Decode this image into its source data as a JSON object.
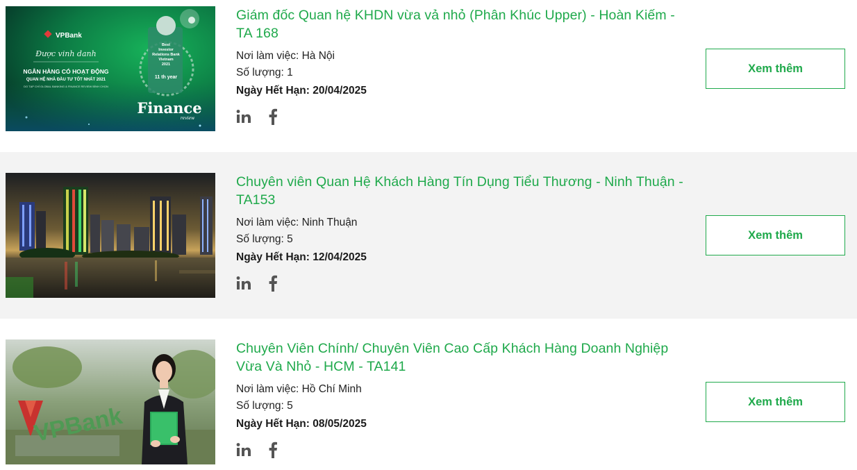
{
  "jobs": [
    {
      "title": "Giám đốc Quan hệ KHDN vừa vả nhỏ (Phân Khúc Upper) - Hoàn Kiếm - TA 168",
      "location_label": "Nơi làm việc:",
      "location": "Hà Nội",
      "quantity_label": "Số lượng:",
      "quantity": "1",
      "deadline_label": "Ngày Hết Hạn:",
      "deadline": "20/04/2025",
      "button": "Xem thêm",
      "image": {
        "brand": "VPBank",
        "script": "Được vinh danh",
        "headline1": "NGÂN HÀNG CÓ HOẠT ĐỘNG",
        "headline2": "QUAN HỆ NHÀ ĐẦU TƯ TỐT NHẤT 2021",
        "small": "DO TẠP CHÍ GLOBAL BANKING & FINANCE REVIEW BÌNH CHỌN",
        "award1": "Best",
        "award2": "Investor",
        "award3": "Relations Bank",
        "award4": "Vietnam",
        "award5": "2021",
        "award6": "11 th year",
        "award_big": "Finance",
        "award_small": "review"
      }
    },
    {
      "title": "Chuyên viên Quan Hệ Khách Hàng Tín Dụng Tiểu Thương - Ninh Thuận - TA153",
      "location_label": "Nơi làm việc:",
      "location": "Ninh Thuận",
      "quantity_label": "Số lượng:",
      "quantity": "5",
      "deadline_label": "Ngày Hết Hạn:",
      "deadline": "12/04/2025",
      "button": "Xem thêm"
    },
    {
      "title": "Chuyên Viên Chính/ Chuyên Viên Cao Cấp Khách Hàng Doanh Nghiệp Vừa Và Nhỏ - HCM - TA141",
      "location_label": "Nơi làm việc:",
      "location": "Hồ Chí Minh",
      "quantity_label": "Số lượng:",
      "quantity": "5",
      "deadline_label": "Ngày Hết Hạn:",
      "deadline": "08/05/2025",
      "button": "Xem thêm",
      "image": {
        "sign": "VPBank"
      }
    }
  ],
  "icons": [
    "linkedin-icon",
    "facebook-icon"
  ],
  "colors": {
    "accent": "#1fa94b",
    "alt_row": "#f3f3f3",
    "icon": "#555555"
  }
}
